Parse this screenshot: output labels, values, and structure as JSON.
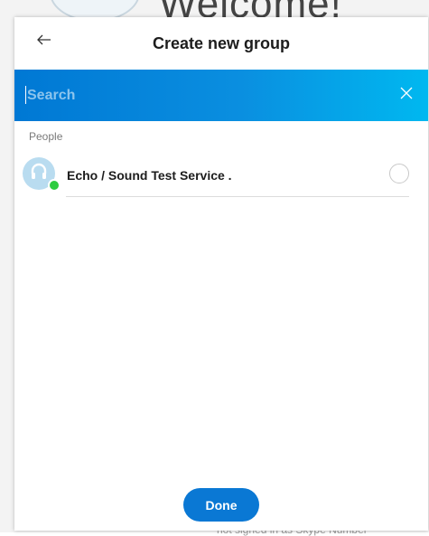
{
  "background": {
    "welcome_text": "Welcome!",
    "footer_text": "not signed in as Skype Number"
  },
  "dialog": {
    "title": "Create new group",
    "back_icon": "arrow-left-icon",
    "search": {
      "placeholder": "Search",
      "value": "",
      "clear_icon": "close-icon"
    },
    "section_label": "People",
    "contacts": [
      {
        "name": "Echo / Sound Test Service .",
        "status": "online",
        "selected": false
      }
    ],
    "done_label": "Done"
  },
  "colors": {
    "accent": "#0078d4",
    "search_gradient_end": "#00b8f0",
    "presence_online": "#2ecc40",
    "avatar_bg": "#b9dcf0"
  }
}
